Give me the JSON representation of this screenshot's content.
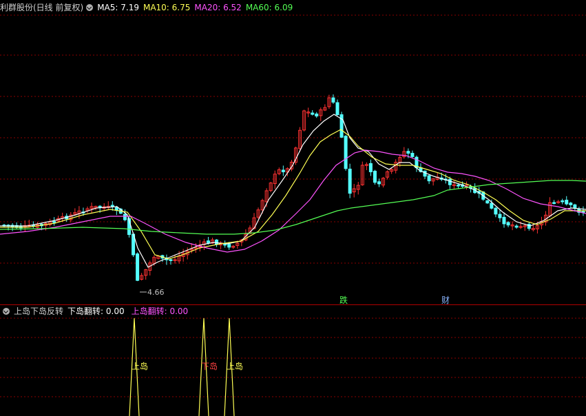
{
  "main_panel": {
    "title": "利群股份(日线 前复权)",
    "indicators": [
      {
        "label": "MA5: 7.19",
        "color": "#ffffff"
      },
      {
        "label": "MA10: 6.75",
        "color": "#ffff54"
      },
      {
        "label": "MA20: 6.52",
        "color": "#ff54ff"
      },
      {
        "label": "MA60: 6.09",
        "color": "#54ff54"
      }
    ],
    "low_price_label": "4.66",
    "event_tags": [
      {
        "text": "跌",
        "color": "#54ff54"
      },
      {
        "text": "财",
        "color": "#8ab4ff"
      }
    ]
  },
  "sub_panel": {
    "title": "上岛下岛反转",
    "indicators": [
      {
        "label": "下岛翻转: 0.00",
        "color": "#ffffff"
      },
      {
        "label": "上岛翻转: 0.00",
        "color": "#ff54ff"
      }
    ],
    "signal_labels": [
      {
        "text": "上岛",
        "color": "#ffff54"
      },
      {
        "text": "下岛",
        "color": "#ff4040"
      },
      {
        "text": "上岛",
        "color": "#ffff54"
      }
    ]
  },
  "colors": {
    "up_candle": "#ff3232",
    "down_candle": "#54ffff",
    "grid": "#8b0000",
    "divider": "#b00000",
    "ma5": "#ffffff",
    "ma10": "#ffff54",
    "ma20": "#ff54ff",
    "ma60": "#54ff54",
    "signal_line": "#ffff54"
  },
  "chart_data": {
    "type": "candlestick",
    "title": "利群股份(日线 前复权)",
    "series": [
      {
        "name": "MA5",
        "last": 7.19
      },
      {
        "name": "MA10",
        "last": 6.75
      },
      {
        "name": "MA20",
        "last": 6.52
      },
      {
        "name": "MA60",
        "last": 6.09
      }
    ],
    "annotations": [
      "4.66",
      "跌",
      "财"
    ]
  }
}
